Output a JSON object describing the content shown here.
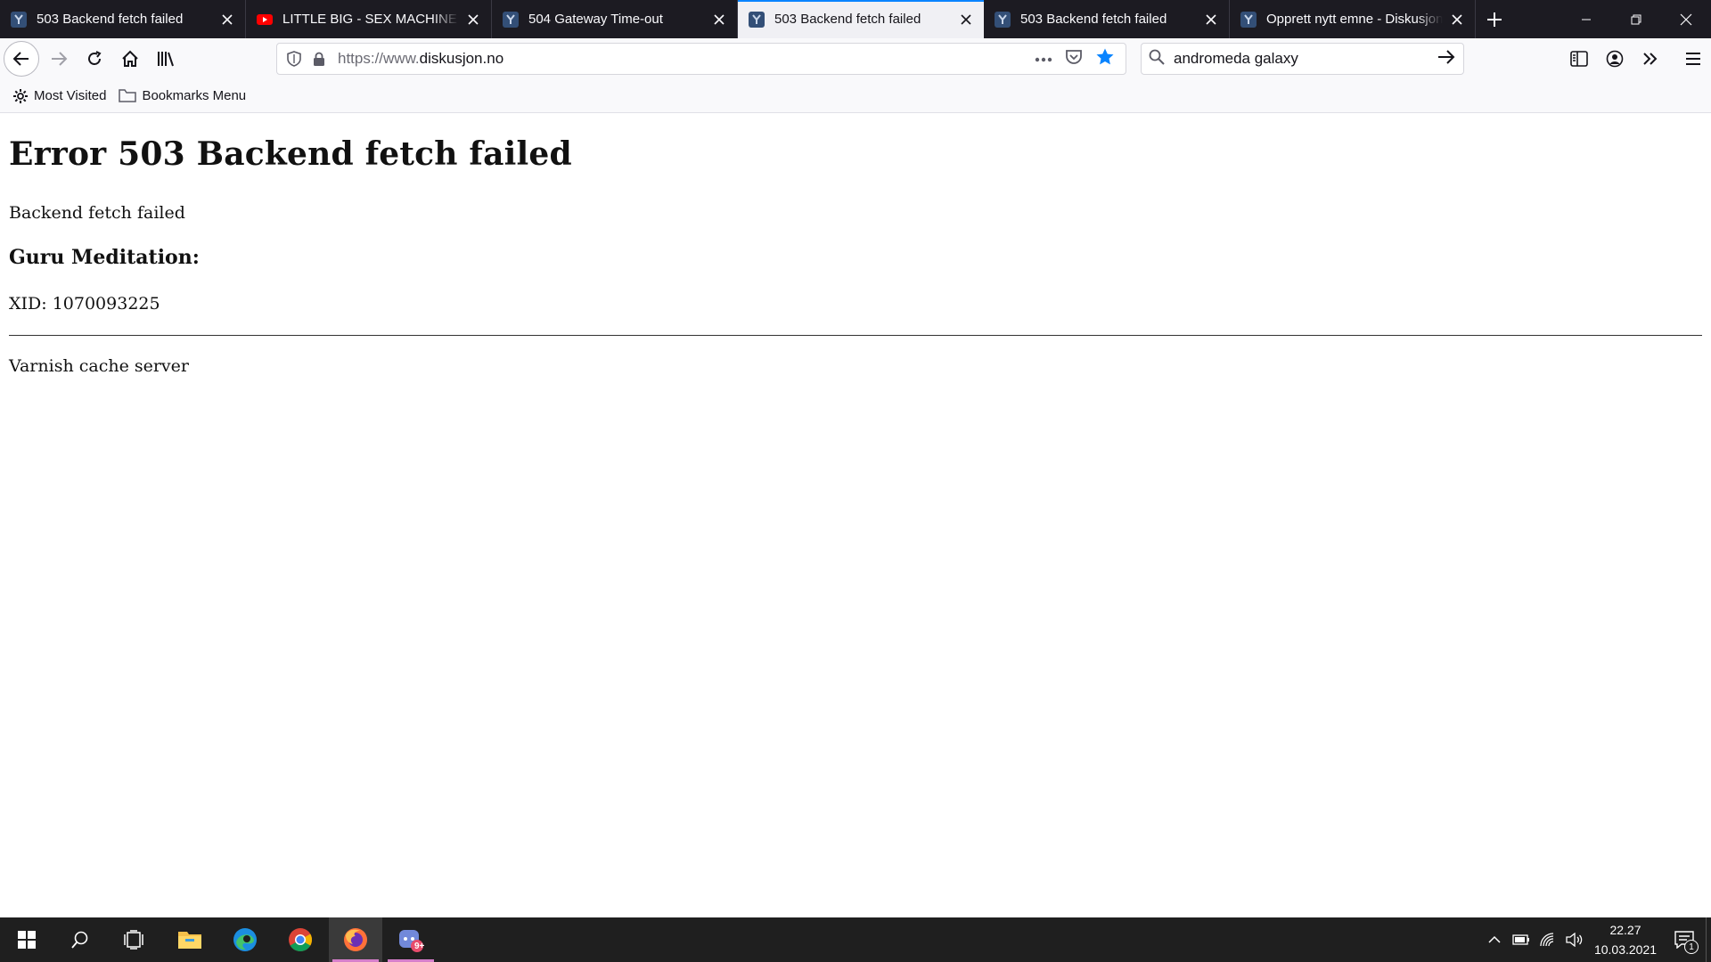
{
  "browser": {
    "tabs": [
      {
        "title": "503 Backend fetch failed",
        "favicon": "diskusjon-favicon",
        "active": false
      },
      {
        "title": "LITTLE BIG - SEX MACHINE (Offi",
        "favicon": "youtube-favicon",
        "active": false
      },
      {
        "title": "504 Gateway Time-out",
        "favicon": "diskusjon-favicon",
        "active": false
      },
      {
        "title": "503 Backend fetch failed",
        "favicon": "diskusjon-favicon",
        "active": true
      },
      {
        "title": "503 Backend fetch failed",
        "favicon": "diskusjon-favicon",
        "active": false
      },
      {
        "title": "Opprett nytt emne - Diskusjon.no",
        "favicon": "diskusjon-favicon",
        "active": false
      }
    ],
    "urlbar": {
      "prefix": "https://www.",
      "domain": "diskusjon.no"
    },
    "search": {
      "value": "andromeda galaxy"
    },
    "bookmarks": [
      {
        "label": "Most Visited",
        "icon": "gear-icon"
      },
      {
        "label": "Bookmarks Menu",
        "icon": "folder-icon"
      }
    ],
    "accent_color": "#0a84ff"
  },
  "page": {
    "heading": "Error 503 Backend fetch failed",
    "status": "Backend fetch failed",
    "subheading": "Guru Meditation:",
    "xid": "XID: 1070093225",
    "server": "Varnish cache server"
  },
  "taskbar": {
    "apps": [
      "start-icon",
      "search-icon",
      "task-view-icon",
      "file-explorer-icon",
      "edge-icon",
      "chrome-icon",
      "firefox-icon",
      "discord-icon"
    ],
    "discord_badge": "9+",
    "time": "22.27",
    "date": "10.03.2021",
    "notification_count": "1"
  }
}
